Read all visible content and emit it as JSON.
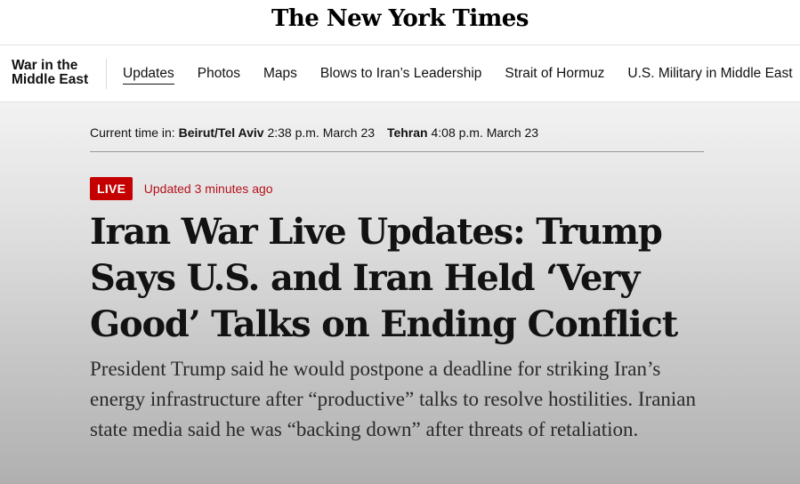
{
  "masthead": {
    "logo_text": "The New York Times"
  },
  "section_nav": {
    "title": "War in the Middle East",
    "items": [
      {
        "label": "Updates",
        "active": true
      },
      {
        "label": "Photos",
        "active": false
      },
      {
        "label": "Maps",
        "active": false
      },
      {
        "label": "Blows to Iran’s Leadership",
        "active": false
      },
      {
        "label": "Strait of Hormuz",
        "active": false
      },
      {
        "label": "U.S. Military in Middle East",
        "active": false
      }
    ]
  },
  "current_time": {
    "prefix": "Current time in:",
    "zones": [
      {
        "city": "Beirut/Tel Aviv",
        "time": "2:38 p.m. March 23"
      },
      {
        "city": "Tehran",
        "time": "4:08 p.m. March 23"
      }
    ]
  },
  "live": {
    "badge": "LIVE",
    "updated": "Updated 3 minutes ago"
  },
  "article": {
    "headline": "Iran War Live Updates: Trump Says U.S. and Iran Held ‘Very Good’ Talks on Ending Conflict",
    "summary": "President Trump said he would postpone a deadline for striking Iran’s energy infrastructure after “productive” talks to resolve hostilities. Iranian state media said he was “backing down” after threats of retaliation."
  },
  "colors": {
    "live_red": "#c40000",
    "updated_red": "#b5121b",
    "text": "#121212"
  }
}
